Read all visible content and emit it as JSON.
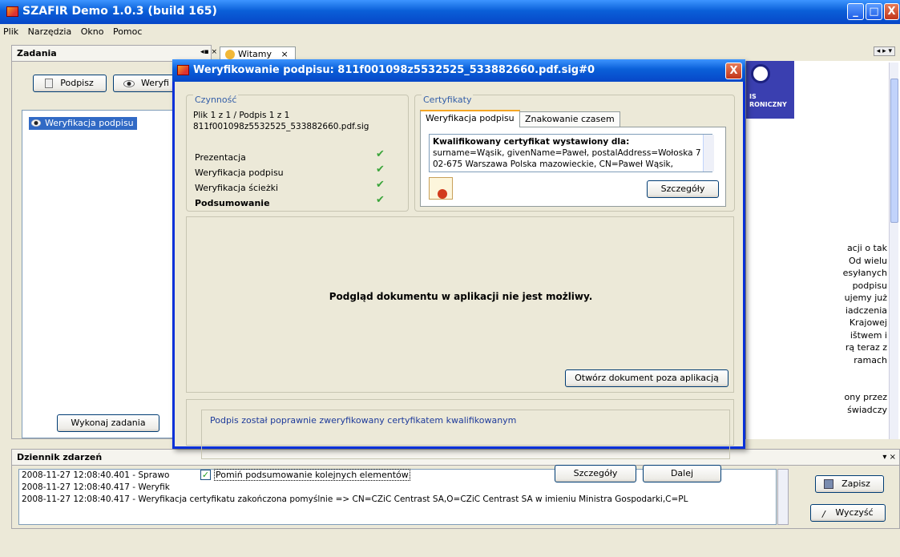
{
  "app": {
    "title": "SZAFIR Demo 1.0.3 (build 165)",
    "window_controls": {
      "minimize": "_",
      "maximize": "□",
      "close": "X"
    }
  },
  "menu": [
    "Plik",
    "Narzędzia",
    "Okno",
    "Pomoc"
  ],
  "tasks_panel": {
    "title": "Zadania",
    "sign_button": "Podpisz",
    "verify_button": "Weryfi",
    "items": [
      "Weryfikacja podpisu"
    ],
    "run_button": "Wykonaj zadania"
  },
  "tabs": [
    {
      "label": "Witamy"
    }
  ],
  "background_text": "acji o tak\n Od wielu\nesyłanych\npodpisu\nujemy już\niadczenia\nKrajowej\ništwem i\nrą teraz z\nramach\n\n\nony przez\nświadczy",
  "banner_text": "IS\nRONICZNY",
  "dialog": {
    "title": "Weryfikowanie podpisu: 811f001098z5532525_533882660.pdf.sig#0",
    "close": "X",
    "czynnosc": {
      "label": "Czynność",
      "line1": "Plik 1 z 1 / Podpis 1 z 1",
      "line2": "811f001098z5532525_533882660.pdf.sig",
      "steps": [
        {
          "label": "Prezentacja",
          "bold": false
        },
        {
          "label": "Weryfikacja podpisu",
          "bold": false
        },
        {
          "label": "Weryfikacja ścieżki",
          "bold": false
        },
        {
          "label": "Podsumowanie",
          "bold": true
        }
      ]
    },
    "certyfikaty": {
      "label": "Certyfikaty",
      "tabs": [
        "Weryfikacja podpisu",
        "Znakowanie czasem"
      ],
      "cert_heading": "Kwalifikowany certyfikat wystawiony dla:",
      "cert_text": "surname=Wąsik, givenName=Paweł, postalAddress=Wołoska 7 02-675 Warszawa Polska mazowieckie, CN=Paweł Wąsik,",
      "details_button": "Szczegóły"
    },
    "preview_message": "Podgląd dokumentu w aplikacji nie jest możliwy.",
    "open_outside_button": "Otwórz dokument poza aplikacją",
    "status_message": "Podpis został poprawnie zweryfikowany certyfikatem kwalifikowanym",
    "skip_checkbox_label": "Pomiń podsumowanie kolejnych elementów",
    "skip_checked": true,
    "details_button": "Szczegóły",
    "next_button": "Dalej"
  },
  "event_log": {
    "title": "Dziennik zdarzeń",
    "lines": [
      "2008-11-27 12:08:40.401 - Sprawo",
      "2008-11-27 12:08:40.417 - Weryfik",
      "2008-11-27 12:08:40.417 - Weryfikacja certyfikatu zakończona pomyślnie => CN=CZiC Centrast SA,O=CZiC Centrast SA w imieniu Ministra Gospodarki,C=PL"
    ],
    "save_button": "Zapisz",
    "clear_button": "Wyczyść"
  }
}
